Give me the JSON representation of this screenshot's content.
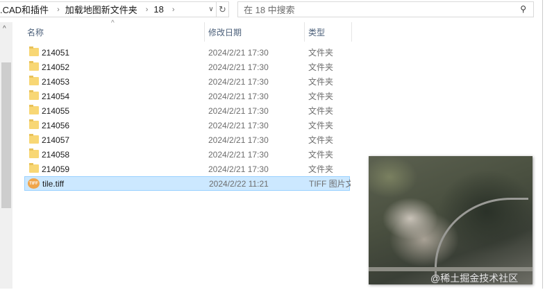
{
  "address": {
    "crumbs": [
      ".CAD和插件",
      "加载地图新文件夹",
      "18"
    ]
  },
  "search": {
    "placeholder": "在 18 中搜索"
  },
  "columns": {
    "name": "名称",
    "date": "修改日期",
    "type": "类型"
  },
  "files": [
    {
      "name": "214051",
      "date": "2024/2/21 17:30",
      "type": "文件夹",
      "icon": "folder"
    },
    {
      "name": "214052",
      "date": "2024/2/21 17:30",
      "type": "文件夹",
      "icon": "folder"
    },
    {
      "name": "214053",
      "date": "2024/2/21 17:30",
      "type": "文件夹",
      "icon": "folder"
    },
    {
      "name": "214054",
      "date": "2024/2/21 17:30",
      "type": "文件夹",
      "icon": "folder"
    },
    {
      "name": "214055",
      "date": "2024/2/21 17:30",
      "type": "文件夹",
      "icon": "folder"
    },
    {
      "name": "214056",
      "date": "2024/2/21 17:30",
      "type": "文件夹",
      "icon": "folder"
    },
    {
      "name": "214057",
      "date": "2024/2/21 17:30",
      "type": "文件夹",
      "icon": "folder"
    },
    {
      "name": "214058",
      "date": "2024/2/21 17:30",
      "type": "文件夹",
      "icon": "folder"
    },
    {
      "name": "214059",
      "date": "2024/2/21 17:30",
      "type": "文件夹",
      "icon": "folder"
    },
    {
      "name": "tile.tiff",
      "date": "2024/2/22 11:21",
      "type": "TIFF 图片文件",
      "icon": "tiff",
      "selected": true
    }
  ],
  "tiff_icon_label": "TIFF",
  "watermark": "@稀土掘金技术社区"
}
